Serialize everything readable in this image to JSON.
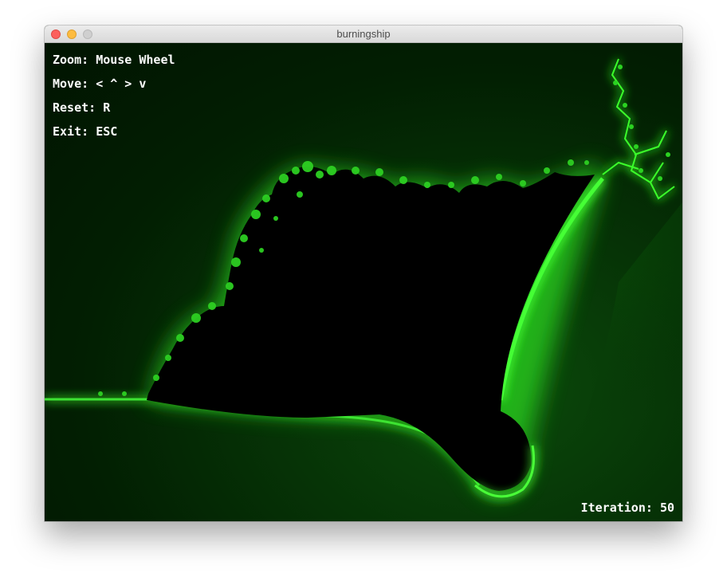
{
  "window": {
    "title": "burningship"
  },
  "controls": {
    "zoom": {
      "key": "Zoom:",
      "value": "Mouse Wheel"
    },
    "move": {
      "key": "Move:",
      "value": "< ^ > v"
    },
    "reset": {
      "key": "Reset:",
      "value": "R"
    },
    "exit": {
      "key": "Exit:",
      "value": "ESC"
    }
  },
  "status": {
    "iteration_label": "Iteration:",
    "iteration_value": "50"
  },
  "colors": {
    "fractal_glow": "#35e82a",
    "background": "#011a01",
    "set_interior": "#000000"
  }
}
